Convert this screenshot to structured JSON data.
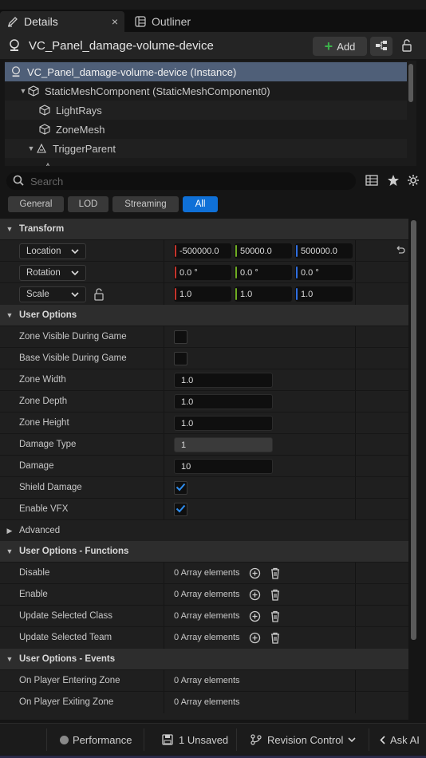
{
  "tabs": {
    "details": "Details",
    "outliner": "Outliner",
    "close": "×"
  },
  "actor": {
    "name": "VC_Panel_damage-volume-device",
    "add_label": "Add"
  },
  "tree": {
    "items": [
      {
        "label": "VC_Panel_damage-volume-device (Instance)"
      },
      {
        "label": "StaticMeshComponent (StaticMeshComponent0)"
      },
      {
        "label": "LightRays"
      },
      {
        "label": "ZoneMesh"
      },
      {
        "label": "TriggerParent"
      }
    ]
  },
  "search": {
    "placeholder": "Search"
  },
  "filters": [
    "General",
    "LOD",
    "Streaming",
    "All"
  ],
  "transform": {
    "title": "Transform",
    "location": {
      "mode": "Location",
      "x": "-500000.0",
      "y": "50000.0",
      "z": "500000.0"
    },
    "rotation": {
      "mode": "Rotation",
      "x": "0.0 °",
      "y": "0.0 °",
      "z": "0.0 °"
    },
    "scale": {
      "mode": "Scale",
      "x": "1.0",
      "y": "1.0",
      "z": "1.0"
    }
  },
  "user_options": {
    "title": "User Options",
    "zone_visible": "Zone Visible During Game",
    "base_visible": "Base Visible During Game",
    "zone_width": {
      "label": "Zone Width",
      "value": "1.0"
    },
    "zone_depth": {
      "label": "Zone Depth",
      "value": "1.0"
    },
    "zone_height": {
      "label": "Zone Height",
      "value": "1.0"
    },
    "damage_type": {
      "label": "Damage Type",
      "value": "1"
    },
    "damage": {
      "label": "Damage",
      "value": "10"
    },
    "shield_damage": "Shield Damage",
    "enable_vfx": "Enable VFX",
    "advanced": "Advanced"
  },
  "functions": {
    "title": "User Options - Functions",
    "rows": [
      {
        "label": "Disable",
        "value": "0 Array elements"
      },
      {
        "label": "Enable",
        "value": "0 Array elements"
      },
      {
        "label": "Update Selected Class",
        "value": "0 Array elements"
      },
      {
        "label": "Update Selected Team",
        "value": "0 Array elements"
      }
    ]
  },
  "events": {
    "title": "User Options - Events",
    "rows": [
      {
        "label": "On Player Entering Zone",
        "value": "0 Array elements"
      },
      {
        "label": "On Player Exiting Zone",
        "value": "0 Array elements"
      }
    ]
  },
  "status": {
    "performance": "Performance",
    "unsaved": "1 Unsaved",
    "revision": "Revision Control",
    "ask_ai": "Ask AI"
  },
  "colors": {
    "accent": "#0f70d7",
    "selection": "#4f5f78",
    "axis_x": "#c4342c",
    "axis_y": "#6fad23",
    "axis_z": "#2f6ee0"
  }
}
